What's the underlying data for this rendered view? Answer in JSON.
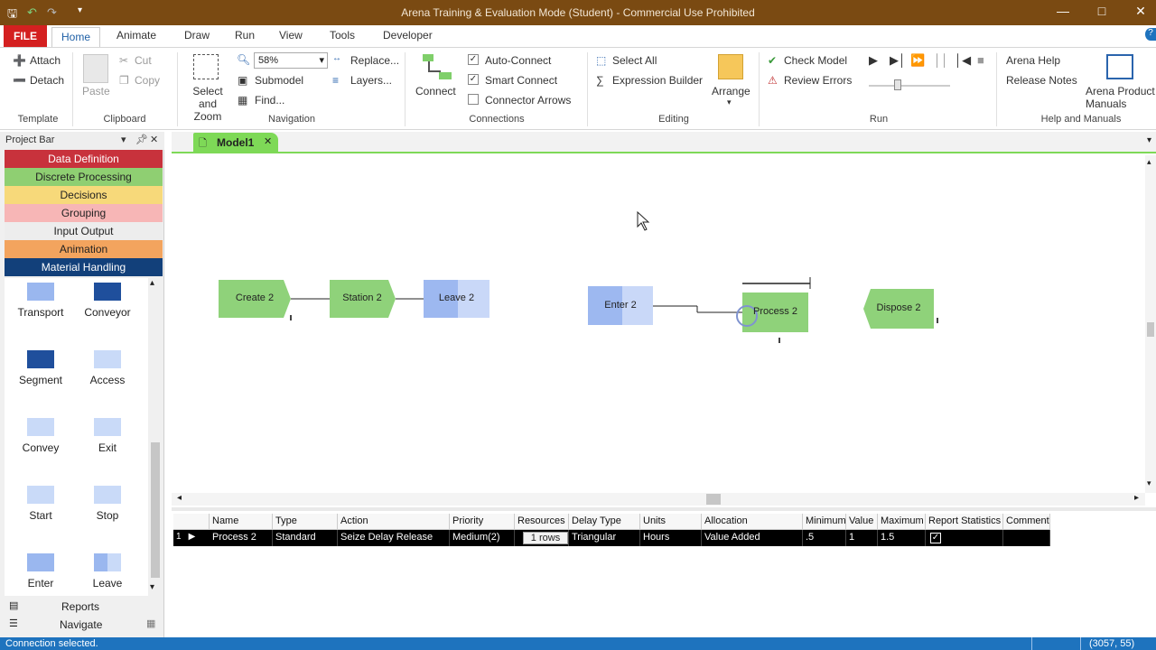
{
  "window": {
    "title": "Arena Training & Evaluation Mode (Student) - Commercial Use Prohibited"
  },
  "tabs": {
    "file": "FILE",
    "home": "Home",
    "animate": "Animate",
    "draw": "Draw",
    "run": "Run",
    "view": "View",
    "tools": "Tools",
    "developer": "Developer"
  },
  "ribbon": {
    "template": {
      "attach": "Attach",
      "detach": "Detach",
      "group": "Template"
    },
    "clipboard": {
      "paste": "Paste",
      "cut": "Cut",
      "copy": "Copy",
      "group": "Clipboard"
    },
    "navigation": {
      "select_zoom": "Select and Zoom",
      "zoom_value": "58%",
      "submodel": "Submodel",
      "find": "Find...",
      "replace": "Replace...",
      "layers": "Layers...",
      "group": "Navigation"
    },
    "connections": {
      "connect": "Connect",
      "auto_connect": "Auto-Connect",
      "smart_connect": "Smart Connect",
      "connector_arrows": "Connector Arrows",
      "group": "Connections"
    },
    "editing": {
      "select_all": "Select All",
      "expression_builder": "Expression Builder",
      "arrange": "Arrange",
      "group": "Editing"
    },
    "run": {
      "check_model": "Check Model",
      "review_errors": "Review Errors",
      "group": "Run"
    },
    "help": {
      "arena_help": "Arena Help",
      "release_notes": "Release Notes",
      "product_manuals": "Arena Product Manuals",
      "group": "Help and Manuals"
    }
  },
  "project_bar": {
    "title": "Project Bar",
    "panels": [
      "Data Definition",
      "Discrete Processing",
      "Decisions",
      "Grouping",
      "Input Output",
      "Animation",
      "Material Handling"
    ],
    "panel_colors": [
      "#c8323c",
      "#8fcf72",
      "#f7d97a",
      "#f7b6b6",
      "#ededed",
      "#f3a45e",
      "#12407a"
    ],
    "modules": [
      "Transport",
      "Conveyor",
      "Segment",
      "Access",
      "Convey",
      "Exit",
      "Start",
      "Stop",
      "Enter",
      "Leave"
    ],
    "footer": [
      "Reports",
      "Navigate"
    ]
  },
  "document": {
    "tab": "Model1"
  },
  "canvas": {
    "modules": [
      "Create 2",
      "Station 2",
      "Leave 2",
      "Enter 2",
      "Process 2",
      "Dispose 2"
    ]
  },
  "grid": {
    "headers": [
      "Name",
      "Type",
      "Action",
      "Priority",
      "Resources",
      "Delay Type",
      "Units",
      "Allocation",
      "Minimum",
      "Value",
      "Maximum",
      "Report Statistics",
      "Comment"
    ],
    "row_number": "1",
    "row": [
      "Process 2",
      "Standard",
      "Seize Delay Release",
      "Medium(2)",
      "1 rows",
      "Triangular",
      "Hours",
      "Value Added",
      ".5",
      "1",
      "1.5",
      "✓",
      ""
    ]
  },
  "status": {
    "message": "Connection selected.",
    "coords": "(3057, 55)"
  }
}
